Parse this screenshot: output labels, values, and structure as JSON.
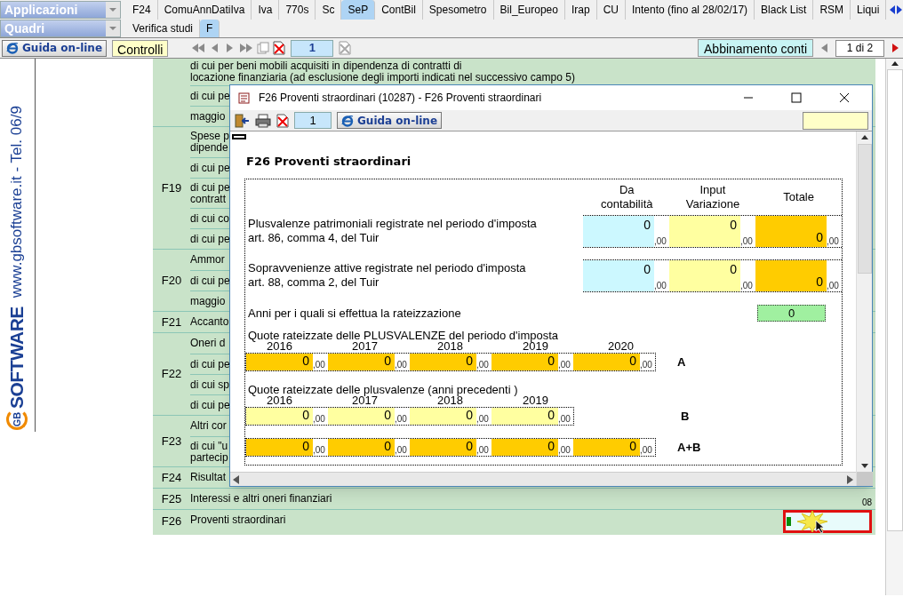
{
  "app_selector": {
    "label": "Applicazioni"
  },
  "tabs": [
    {
      "label": "F24",
      "selected": false
    },
    {
      "label": "ComuAnnDatiIva",
      "selected": false
    },
    {
      "label": "Iva",
      "selected": false
    },
    {
      "label": "770s",
      "selected": false
    },
    {
      "label": "Sc",
      "selected": false
    },
    {
      "label": "SeP",
      "selected": true
    },
    {
      "label": "ContBil",
      "selected": false
    },
    {
      "label": "Spesometro",
      "selected": false
    },
    {
      "label": "Bil_Europeo",
      "selected": false
    },
    {
      "label": "Irap",
      "selected": false
    },
    {
      "label": "CU",
      "selected": false
    },
    {
      "label": "Intento (fino al 28/02/17)",
      "selected": false
    },
    {
      "label": "Black List",
      "selected": false
    },
    {
      "label": "RSM",
      "selected": false
    },
    {
      "label": "Liqui",
      "selected": false
    }
  ],
  "section_selector": {
    "label": "Quadri"
  },
  "subtabs": [
    {
      "label": "Verifica studi",
      "selected": false
    },
    {
      "label": "F",
      "selected": true
    }
  ],
  "toolbar": {
    "help_button": "Guida on-line",
    "controls_button": "Controlli",
    "page": "1",
    "match_button": "Abbinamento conti",
    "pager": "1 di 2"
  },
  "sidebar": {
    "logo": "GB",
    "brand": "SOFTWARE",
    "contact": "www.gbsoftware.it - Tel. 06/9"
  },
  "form_groups": [
    {
      "items": [
        [
          "di cui per beni mobili acquisiti in dipendenza di contratti di",
          "locazione finanziaria (ad esclusione degli importi indicati nel successivo campo 5)"
        ],
        [
          "di cui pe"
        ],
        [
          "maggio"
        ]
      ]
    },
    {
      "code": "F19",
      "items": [
        [
          "Spese p",
          "dipende"
        ],
        [
          "di cui pe"
        ],
        [
          "di cui pe",
          "contratt"
        ],
        [
          "di cui co"
        ],
        [
          "di cui pe"
        ]
      ]
    },
    {
      "code": "F20",
      "items": [
        [
          "Ammor"
        ],
        [
          "di cui pe"
        ],
        [
          "maggio"
        ]
      ]
    },
    {
      "code": "F21",
      "items": [
        [
          "Accanto"
        ]
      ]
    },
    {
      "code": "F22",
      "items": [
        [
          "Oneri d"
        ],
        [
          "di cui pe"
        ],
        [
          "di cui sp"
        ],
        [
          "di cui pe"
        ]
      ]
    },
    {
      "code": "F23",
      "items": [
        [
          "Altri cor"
        ],
        [
          "di cui \"u",
          "partecip"
        ]
      ]
    },
    {
      "code": "F24",
      "items": [
        [
          "Risultat"
        ]
      ]
    },
    {
      "code": "F25",
      "items": [
        [
          "Interessi e altri oneri finanziari"
        ]
      ],
      "value": "08"
    },
    {
      "code": "F26",
      "items": [
        [
          "Proventi straordinari"
        ]
      ],
      "field": {
        "highlighted": true
      }
    }
  ],
  "dialog": {
    "title": "F26 Proventi straordinari (10287) - F26 Proventi straordinari",
    "page": "1",
    "help_button": "Guida on-line",
    "heading": "F26 Proventi straordinari",
    "columns": [
      "Da contabilità",
      "Input Variazione",
      "Totale"
    ],
    "rows": [
      {
        "label": [
          "Plusvalenze patrimoniali registrate nel periodo d'imposta",
          "art. 86, comma 4, del Tuir"
        ],
        "cells": [
          {
            "kind": "accounting",
            "value": "0",
            "decimals": ",00"
          },
          {
            "kind": "input",
            "value": "0",
            "decimals": ",00"
          },
          {
            "kind": "total",
            "value": "0",
            "decimals": ",00"
          }
        ]
      },
      {
        "label": [
          "Sopravvenienze attive registrate nel periodo d'imposta",
          "art. 88, comma 2, del Tuir"
        ],
        "cells": [
          {
            "kind": "accounting",
            "value": "0",
            "decimals": ",00"
          },
          {
            "kind": "input",
            "value": "0",
            "decimals": ",00"
          },
          {
            "kind": "total",
            "value": "0",
            "decimals": ",00"
          }
        ]
      }
    ],
    "installments": {
      "label": "Anni per i quali si effettua la rateizzazione",
      "value": "0"
    },
    "sections": [
      {
        "title": "Quote rateizzate delle PLUSVALENZE del periodo d'imposta",
        "years": [
          "2016",
          "2017",
          "2018",
          "2019",
          "2020"
        ],
        "letter": "A",
        "cells": [
          {
            "kind": "total",
            "value": "0",
            "decimals": ",00"
          },
          {
            "kind": "total",
            "value": "0",
            "decimals": ",00"
          },
          {
            "kind": "total",
            "value": "0",
            "decimals": ",00"
          },
          {
            "kind": "total",
            "value": "0",
            "decimals": ",00"
          },
          {
            "kind": "total",
            "value": "0",
            "decimals": ",00"
          }
        ]
      },
      {
        "title": "Quote rateizzate delle plusvalenze  (anni precedenti )",
        "years": [
          "2016",
          "2017",
          "2018",
          "2019"
        ],
        "letter": "B",
        "cells": [
          {
            "kind": "input",
            "value": "0",
            "decimals": ",00"
          },
          {
            "kind": "input",
            "value": "0",
            "decimals": ",00"
          },
          {
            "kind": "input",
            "value": "0",
            "decimals": ",00"
          },
          {
            "kind": "input",
            "value": "0",
            "decimals": ",00"
          }
        ]
      },
      {
        "letter": "A+B",
        "cells": [
          {
            "kind": "total",
            "value": "0",
            "decimals": ",00"
          },
          {
            "kind": "total",
            "value": "0",
            "decimals": ",00"
          },
          {
            "kind": "total",
            "value": "0",
            "decimals": ",00"
          },
          {
            "kind": "total",
            "value": "0",
            "decimals": ",00"
          },
          {
            "kind": "total",
            "value": "0",
            "decimals": ",00"
          }
        ]
      }
    ]
  }
}
